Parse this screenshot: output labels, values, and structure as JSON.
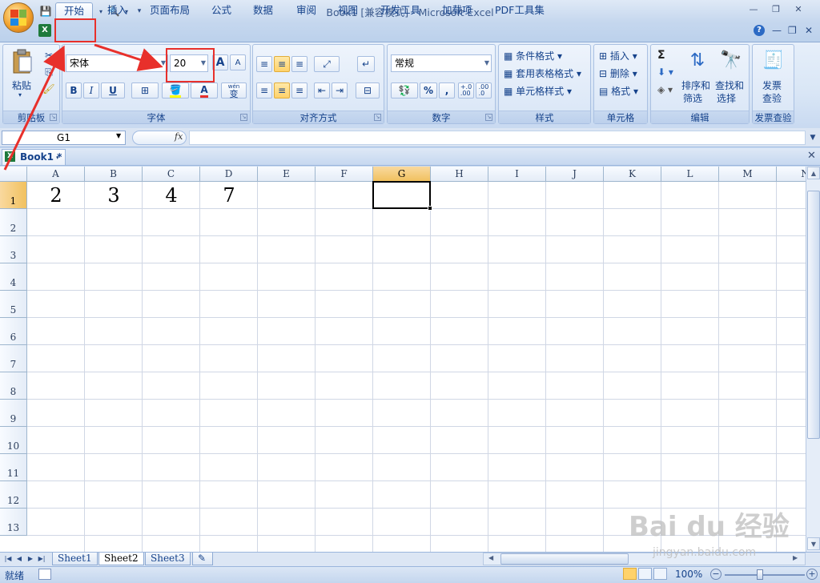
{
  "window": {
    "title": "Book1  [兼容模式] - Microsoft Excel",
    "minimize": "—",
    "restore": "❐",
    "close": "✕"
  },
  "ribbon_tabs": [
    "开始",
    "插入",
    "页面布局",
    "公式",
    "数据",
    "审阅",
    "视图",
    "开发工具",
    "加载项",
    "PDF工具集"
  ],
  "active_tab": "开始",
  "help_icon": "?",
  "clipboard": {
    "paste": "粘贴",
    "label": "剪贴板"
  },
  "font": {
    "name": "宋体",
    "size": "20",
    "label": "字体",
    "bold": "B",
    "italic": "I",
    "underline": "U",
    "grow": "A",
    "shrink": "A",
    "wen": "wén",
    "wen_char": "变"
  },
  "alignment": {
    "label": "对齐方式"
  },
  "number": {
    "format": "常规",
    "label": "数字",
    "percent": "%",
    "comma": ",",
    "inc_decimal": "+.0\n.00",
    "dec_decimal": ".00\n.0"
  },
  "styles": {
    "conditional": "条件格式",
    "table": "套用表格格式",
    "cell": "单元格样式",
    "label": "样式"
  },
  "cells": {
    "insert": "插入",
    "delete": "删除",
    "format": "格式",
    "label": "单元格"
  },
  "editing": {
    "sort": "排序和",
    "sort2": "筛选",
    "find": "查找和",
    "find2": "选择",
    "label": "编辑",
    "sigma": "Σ"
  },
  "invoice": {
    "line1": "发票",
    "line2": "查验",
    "label": "发票查验"
  },
  "formula_bar": {
    "name_box": "G1",
    "fx": "fx",
    "formula": ""
  },
  "workbook_tab": {
    "name": "Book1 *",
    "close": "✕"
  },
  "columns": [
    "A",
    "B",
    "C",
    "D",
    "E",
    "F",
    "G",
    "H",
    "I",
    "J",
    "K",
    "L",
    "M",
    "N"
  ],
  "rows": [
    "1",
    "2",
    "3",
    "4",
    "5",
    "6",
    "7",
    "8",
    "9",
    "10",
    "11",
    "12",
    "13"
  ],
  "cells_data": [
    {
      "ref": "A1",
      "value": "2"
    },
    {
      "ref": "B1",
      "value": "3"
    },
    {
      "ref": "C1",
      "value": "4"
    },
    {
      "ref": "D1",
      "value": "7"
    }
  ],
  "selected_cell": "G1",
  "sheets": [
    "Sheet1",
    "Sheet2",
    "Sheet3"
  ],
  "active_sheet": "Sheet2",
  "status": {
    "text": "就绪",
    "zoom": "100%"
  },
  "watermark": {
    "text": "Bai du 经验",
    "url": "jingyan.baidu.com"
  },
  "colors": {
    "accent": "#15428b",
    "annotation": "#e8302b",
    "selected_header": "#f1c15f"
  }
}
